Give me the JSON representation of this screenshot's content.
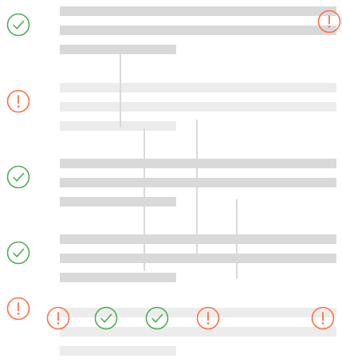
{
  "colors": {
    "success": "#4caf50",
    "warning": "#ff7043",
    "skeleton_strong": "#d9d9d9",
    "skeleton_faint": "#ececec"
  },
  "rows": [
    {
      "icon": "check-circle-icon",
      "status": "success",
      "emphasis": "strong"
    },
    {
      "icon": "alert-circle-icon",
      "status": "warning",
      "emphasis": "faint"
    },
    {
      "icon": "check-circle-icon",
      "status": "success",
      "emphasis": "strong"
    },
    {
      "icon": "check-circle-icon",
      "status": "success",
      "emphasis": "strong"
    },
    {
      "icon": "alert-circle-icon",
      "status": "warning",
      "emphasis": "faint"
    }
  ]
}
